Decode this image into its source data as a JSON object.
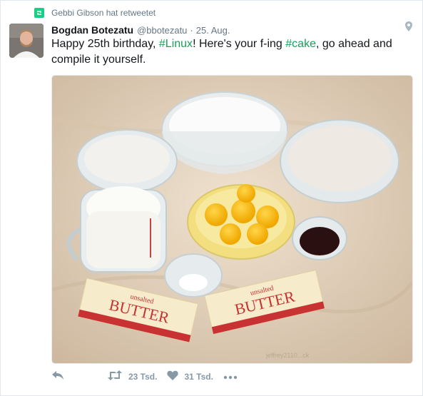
{
  "retweet_context": {
    "text": "Gebbi Gibson hat retweetet",
    "icon": "retweet-icon"
  },
  "tweet": {
    "author_name": "Bogdan Botezatu",
    "handle": "@bbotezatu",
    "separator": "·",
    "date": "25. Aug.",
    "text_parts": {
      "p1": "Happy 25th birthday, ",
      "hashtag1": "#Linux",
      "p2": "! Here's your f-ing ",
      "hashtag2": "#cake",
      "p3": ", go ahead and compile it yourself."
    }
  },
  "media": {
    "description_tag": "photo",
    "butter_text": "BUTTER",
    "butter_sub": "unsalted",
    "watermark": "jeffrey2110...ck"
  },
  "actions": {
    "retweet_count": "23 Tsd.",
    "like_count": "31 Tsd."
  },
  "colors": {
    "link": "#1b95e0",
    "hashtag": "#19a05a",
    "retweet": "#19cf86",
    "muted": "#657786"
  }
}
